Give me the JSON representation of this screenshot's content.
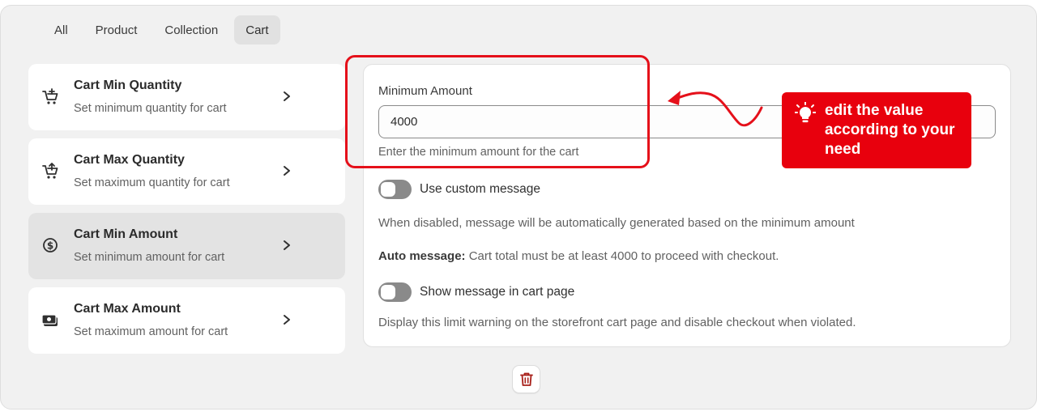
{
  "tabs": [
    {
      "label": "All",
      "active": false
    },
    {
      "label": "Product",
      "active": false
    },
    {
      "label": "Collection",
      "active": false
    },
    {
      "label": "Cart",
      "active": true
    }
  ],
  "rules": [
    {
      "title": "Cart Min Quantity",
      "subtitle": "Set minimum quantity for cart",
      "icon": "cart-plus-icon",
      "selected": false
    },
    {
      "title": "Cart Max Quantity",
      "subtitle": "Set maximum quantity for cart",
      "icon": "cart-up-icon",
      "selected": false
    },
    {
      "title": "Cart Min Amount",
      "subtitle": "Set minimum amount for cart",
      "icon": "dollar-circle-icon",
      "selected": true
    },
    {
      "title": "Cart Max Amount",
      "subtitle": "Set maximum amount for cart",
      "icon": "cash-icon",
      "selected": false
    }
  ],
  "detail": {
    "field_label": "Minimum Amount",
    "field_value": "4000",
    "field_help": "Enter the minimum amount for the cart",
    "custom_message_label": "Use custom message",
    "custom_message_enabled": false,
    "disabled_note": "When disabled, message will be automatically generated based on the minimum amount",
    "auto_message_label": "Auto message:",
    "auto_message_text": "Cart total must be at least 4000 to proceed with checkout.",
    "show_cart_label": "Show message in cart page",
    "show_cart_enabled": false,
    "show_cart_note": "Display this limit warning on the storefront cart page and disable checkout when violated."
  },
  "delete_icon": "trash-icon",
  "annotation": {
    "callout_text": "edit the value according to your need",
    "callout_icon": "lightbulb-icon",
    "color": "#e8000d"
  },
  "colors": {
    "background": "#f1f1f1",
    "selected_item": "#e3e3e3",
    "toggle_off": "#8a8a8a",
    "delete_red": "#a8201a"
  }
}
